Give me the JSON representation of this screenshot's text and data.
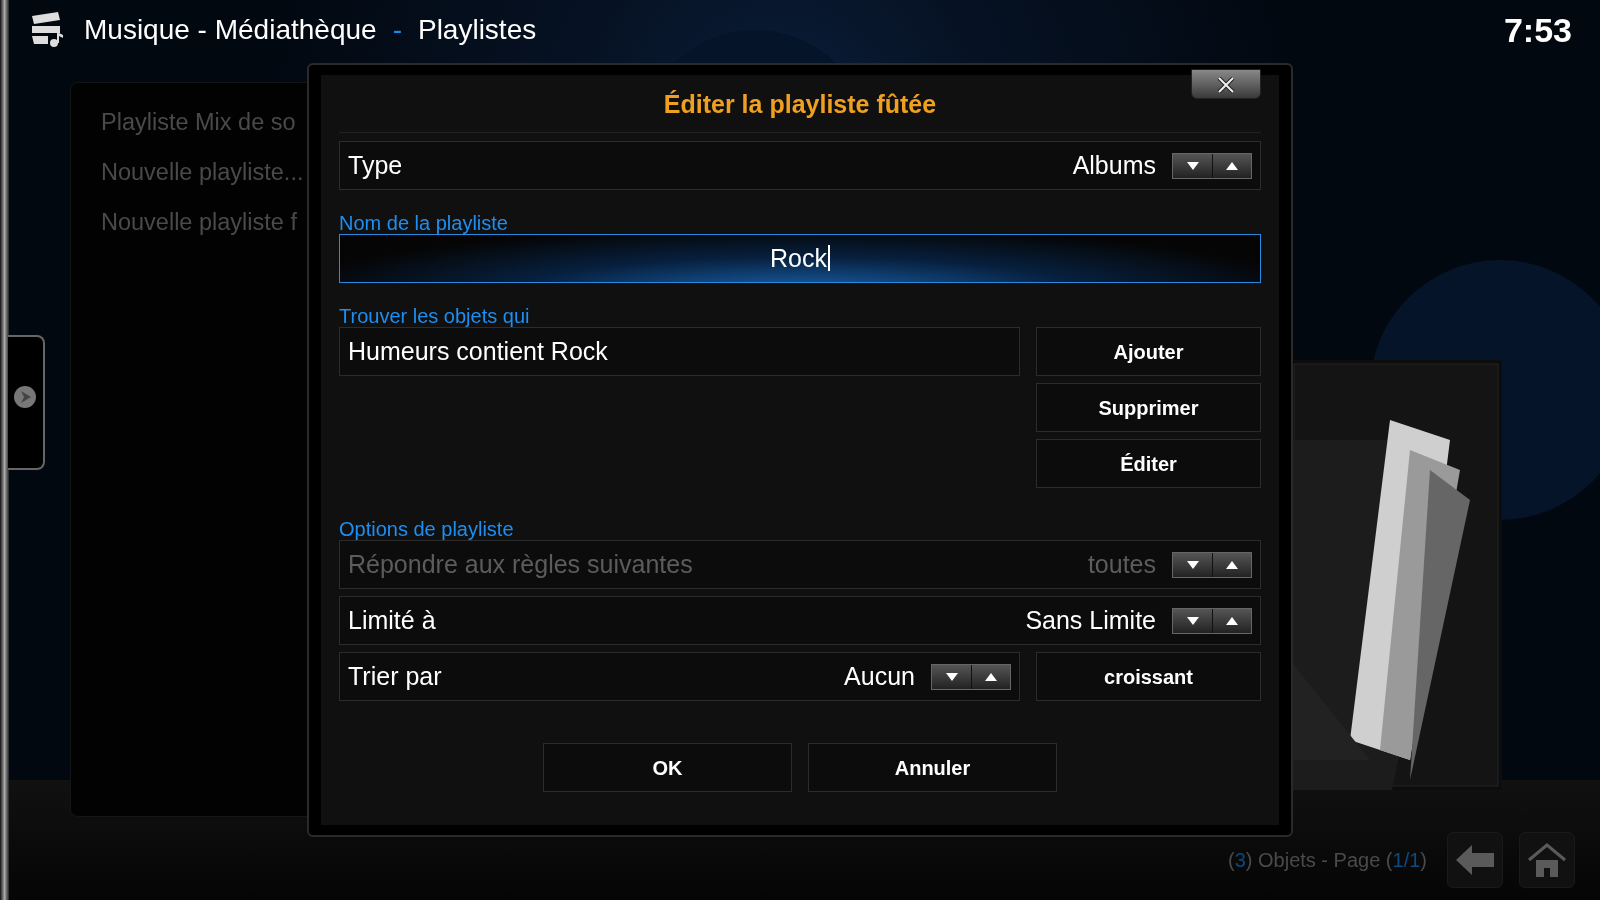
{
  "header": {
    "title": "Musique - Médiathèque",
    "separator": "-",
    "subtitle": "Playlistes",
    "clock": "7:53"
  },
  "sidebar": {
    "items": [
      {
        "label": "Playliste Mix de so"
      },
      {
        "label": "Nouvelle playliste..."
      },
      {
        "label": "Nouvelle playliste f"
      }
    ]
  },
  "dialog": {
    "title": "Éditer la playliste fûtée",
    "type_row": {
      "label": "Type",
      "value": "Albums"
    },
    "name_section": {
      "heading": "Nom de la playliste",
      "value": "Rock",
      "focused": true
    },
    "rules_section": {
      "heading": "Trouver les objets qui",
      "rules": [
        {
          "text": "Humeurs contient Rock"
        }
      ],
      "buttons": [
        "Ajouter",
        "Supprimer",
        "Éditer"
      ]
    },
    "options_section": {
      "heading": "Options de playliste",
      "rows": [
        {
          "label": "Répondre aux règles suivantes",
          "value": "toutes",
          "disabled": true
        },
        {
          "label": "Limité à",
          "value": "Sans Limite",
          "disabled": false
        }
      ],
      "sort": {
        "label": "Trier par",
        "value": "Aucun",
        "order": "croissant"
      }
    },
    "buttons": [
      "OK",
      "Annuler"
    ]
  },
  "footer": {
    "parts": [
      {
        "text": "(",
        "accent": false
      },
      {
        "text": "3",
        "accent": true
      },
      {
        "text": ") Objets - Page (",
        "accent": false
      },
      {
        "text": "1/1",
        "accent": true
      },
      {
        "text": ")",
        "accent": false
      }
    ]
  }
}
